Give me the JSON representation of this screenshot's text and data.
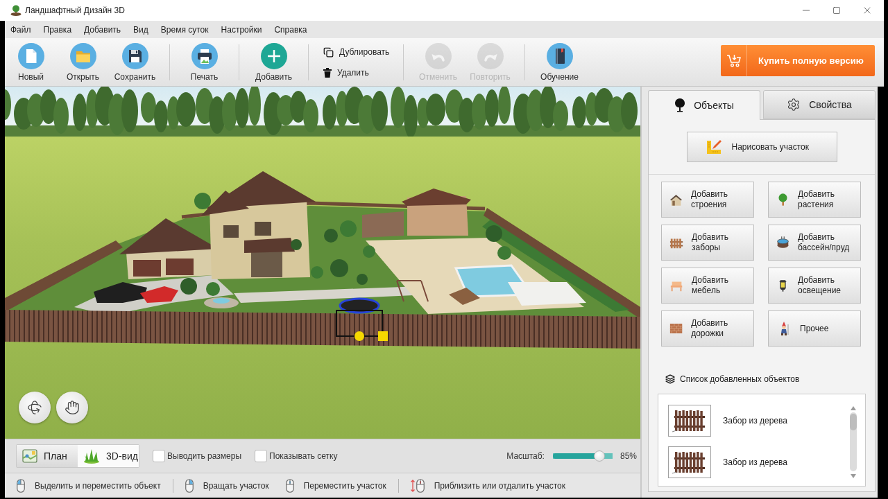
{
  "window": {
    "title": "Ландшафтный Дизайн 3D"
  },
  "menu": [
    "Файл",
    "Правка",
    "Добавить",
    "Вид",
    "Время суток",
    "Настройки",
    "Справка"
  ],
  "toolbar": {
    "groups": [
      {
        "kind": "large",
        "buttons": [
          {
            "label": "Новый",
            "disabled": false
          },
          {
            "label": "Открыть",
            "disabled": false
          },
          {
            "label": "Сохранить",
            "disabled": false
          }
        ]
      },
      {
        "kind": "large",
        "buttons": [
          {
            "label": "Печать",
            "disabled": false
          }
        ]
      },
      {
        "kind": "large",
        "buttons": [
          {
            "label": "Добавить",
            "disabled": false
          }
        ]
      },
      {
        "kind": "small",
        "buttons": [
          {
            "label": "Дублировать",
            "disabled": false
          },
          {
            "label": "Удалить",
            "disabled": false
          }
        ]
      },
      {
        "kind": "large",
        "buttons": [
          {
            "label": "Отменить",
            "disabled": true
          },
          {
            "label": "Повторить",
            "disabled": true
          }
        ]
      },
      {
        "kind": "large",
        "buttons": [
          {
            "label": "Обучение",
            "disabled": false
          }
        ]
      }
    ],
    "buy_button": "Купить полную версию"
  },
  "side_panel": {
    "tabs": [
      {
        "label": "Объекты",
        "selected": true
      },
      {
        "label": "Свойства",
        "selected": false
      }
    ],
    "draw_button": "Нарисовать участок",
    "add_buttons": [
      "Добавить строения",
      "Добавить растения",
      "Добавить заборы",
      "Добавить бассейн/пруд",
      "Добавить мебель",
      "Добавить освещение",
      "Добавить дорожки",
      "Прочее"
    ],
    "objects_list": {
      "title": "Список добавленных объектов",
      "items": [
        "Забор из дерева",
        "Забор из дерева"
      ]
    }
  },
  "view_bar": {
    "modes": [
      {
        "label": "План",
        "selected": false
      },
      {
        "label": "3D-вид",
        "selected": true
      }
    ],
    "options": [
      {
        "label": "Выводить размеры",
        "checked": false
      },
      {
        "label": "Показывать сетку",
        "checked": false
      }
    ],
    "zoom": {
      "label": "Масштаб:",
      "level": 0.85,
      "reading": "85%"
    }
  },
  "status_bar": {
    "groups": [
      [
        "Выделить и переместить объект"
      ],
      [
        "Вращать участок",
        "Переместить участок"
      ],
      [
        "Приблизить или отдалить участок"
      ]
    ]
  }
}
